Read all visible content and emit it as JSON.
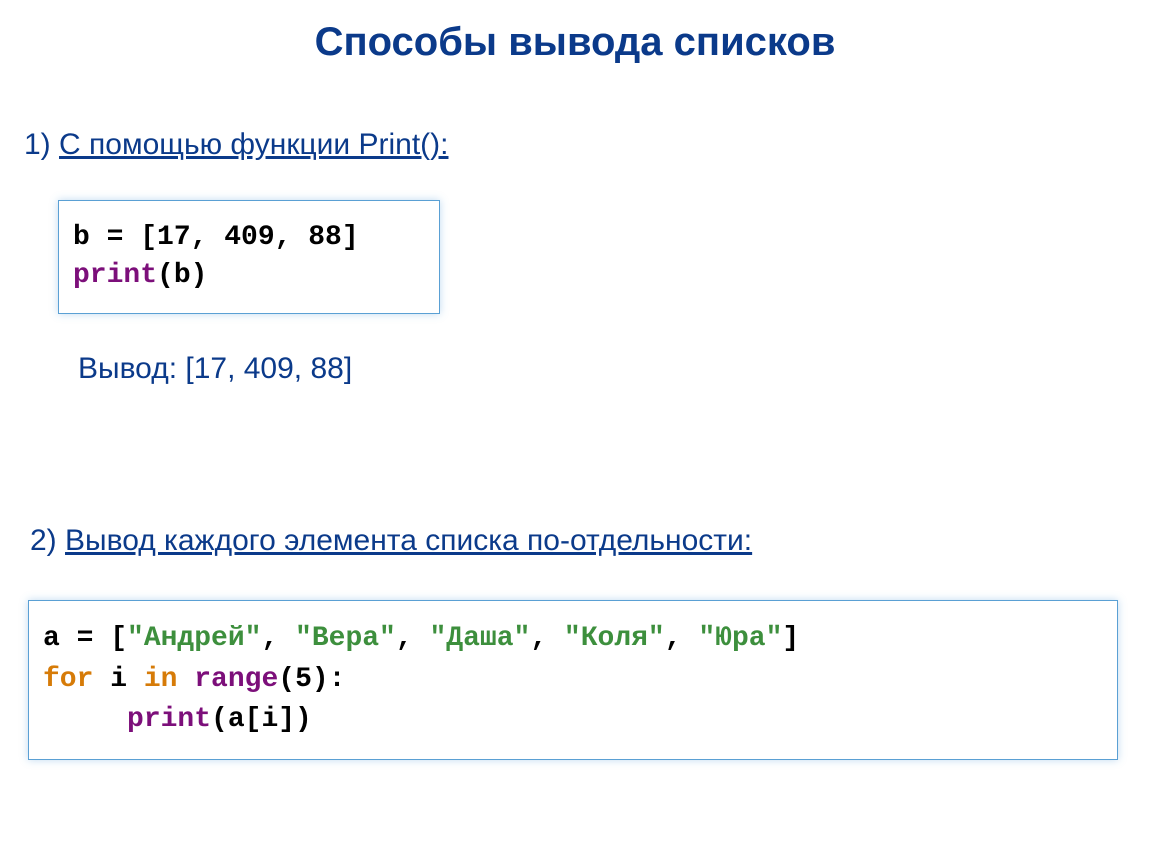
{
  "title": "Способы вывода списков",
  "section1": {
    "num": "1) ",
    "txt": "С помощью функции Print():"
  },
  "code1": {
    "l1": "b = [17, 409, 88]",
    "l2a": "print",
    "l2b": "(b)"
  },
  "output1": "Вывод: [17, 409, 88]",
  "section2": {
    "num": "2) ",
    "txt": "Вывод каждого элемента списка по-отдельности:"
  },
  "code2": {
    "l1a": "a = [",
    "l1b": "\"Андрей\"",
    "l1c": ", ",
    "l1d": "\"Вера\"",
    "l1e": ", ",
    "l1f": "\"Даша\"",
    "l1g": ", ",
    "l1h": "\"Коля\"",
    "l1i": ", ",
    "l1j": "\"Юра\"",
    "l1k": "]",
    "l2a": "for ",
    "l2b": "i ",
    "l2c": "in ",
    "l2d": "range",
    "l2e": "(5):",
    "l3a": "     ",
    "l3b": "print",
    "l3c": "(a[i])"
  }
}
